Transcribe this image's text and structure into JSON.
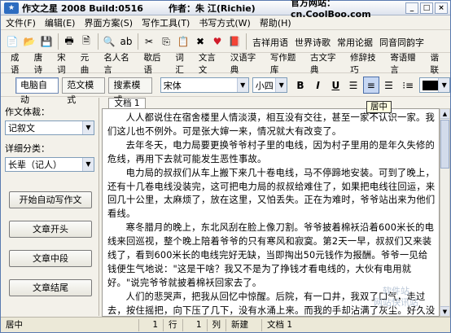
{
  "title": {
    "app": "作文之星 2008 Build:0516",
    "author": "作者：朱 江(Richie)",
    "site": "官方网站：cn.CoolBoo.com"
  },
  "window_controls": {
    "min": "_",
    "max": "□",
    "close": "×"
  },
  "menu": [
    "文件(F)",
    "编辑(E)",
    "界面方案(S)",
    "写作工具(T)",
    "书写方式(W)",
    "帮助(H)"
  ],
  "toolbar_text": [
    "吉祥用语",
    "世界诗歌",
    "常用论据",
    "同音同韵字"
  ],
  "toolbar2": [
    "成语",
    "唐诗",
    "宋词",
    "元曲",
    "名人名言",
    "歇后语",
    "词汇",
    "文言文",
    "汉语字典",
    "写作题库",
    "古文字典",
    "修辞技巧",
    "寄语赠言",
    "谐联"
  ],
  "modes": [
    "电脑自动",
    "范文模式",
    "搜素模式"
  ],
  "font_name": "宋体",
  "font_size": "小四",
  "format": {
    "bold": "B",
    "italic": "I",
    "underline": "U"
  },
  "left": {
    "genre_label": "作文体裁：",
    "genre_value": "记叙文",
    "subtype_label": "详细分类：",
    "subtype_value": "长辈（记人）",
    "buttons": [
      "开始自动写作文",
      "文章开头",
      "文章中段",
      "文章结尾"
    ]
  },
  "tab": "文档 1",
  "tooltip": "居中",
  "paragraphs": [
    "人人都说住在宿舍楼里人情淡漠，相互没有交往，甚至一家不认识一家。我们这儿也不例外。可是张大婶一来，情况就大有改变了。",
    "去年冬天，电力局要更换爷爷村子里的电线，因为村子里用的是年久失修的危线，再用下去就可能发生恶性事故。",
    "电力局的叔叔们从车上搬下来几十卷电线，马不停蹄地安装。可到了晚上，还有十几卷电线没装完，这可把电力局的叔叔给难住了，如果把电线往回运，来回几十公里，太麻烦了，放在这里，又怕丢失。正在为难时，爷爷站出来为他们看线。",
    "寒冬腊月的晚上，东北风刮在脸上像刀割。爷爷披着棉袄沿着600米长的电线来回巡视，整个晚上陪着爷爷的只有寒风和寂寞。第2天一早，叔叔们又来装线了，看到600米长的电线完好无缺，当即掏出50元钱作为报酬。爷爷一见给钱便生气地说：\"这是干啥？我又不是为了挣钱才看电线的，大伙有电用就好。\"说完爷爷就披着棉袄回家去了。",
    "人们的悲哭声，把我从回忆中惊醒。后院，有一口井，我双了口气，走过去，按住摇把，向下压了几下，没有水涌上来。而我的手却沾满了灰尘。好久没有使用这口井了。我使劲压了一阵，终于又见到水流了。"
  ],
  "watermark": "软件站\n网站快讯站",
  "status": [
    "居中",
    "1",
    "行",
    "1",
    "列",
    "新建",
    "文档 1"
  ]
}
